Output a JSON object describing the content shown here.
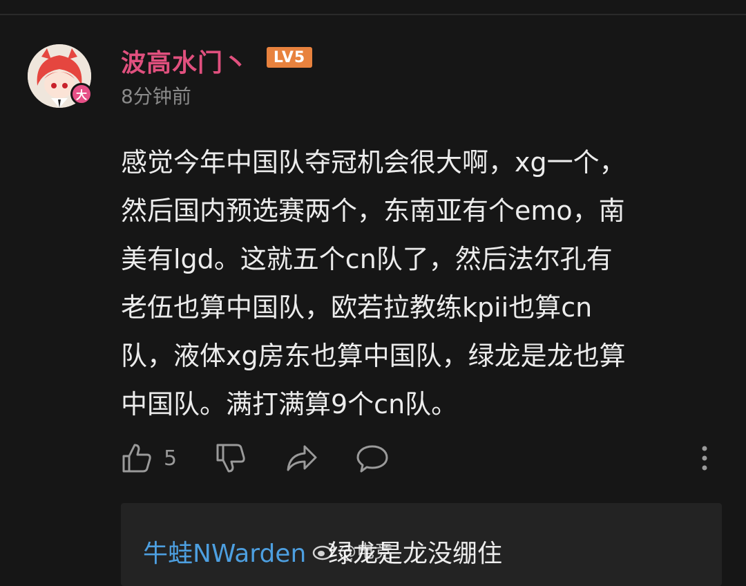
{
  "user": {
    "name": "波高水门丶",
    "level": "LV5",
    "avatar_badge": "大",
    "time": "8分钟前"
  },
  "comment": {
    "lines": [
      "感觉今年中国队夺冠机会很大啊，xg一个，",
      "然后国内预选赛两个，东南亚有个emo，南",
      "美有lgd。这就五个cn队了，然后法尔孔有",
      "老伍也算中国队，欧若拉教练kpii也算cn",
      "队，液体xg房东也算中国队，绿龙是龙也算",
      "中国队。满打满算9个cn队。"
    ]
  },
  "actions": {
    "like_count": "5",
    "icons": [
      "thumbs-up-icon",
      "thumbs-down-icon",
      "share-icon",
      "comment-icon",
      "more-vertical-icon"
    ]
  },
  "reply": {
    "author": "牛蛙NWarden",
    "text": "绿龙是龙没绷住"
  },
  "watermark": {
    "text": "@电竞"
  },
  "colors": {
    "background": "#161616",
    "username": "#e0507e",
    "level_tag": "#e8823e",
    "reply_author": "#4d9fe0",
    "avatar_badge": "#e64f86"
  }
}
